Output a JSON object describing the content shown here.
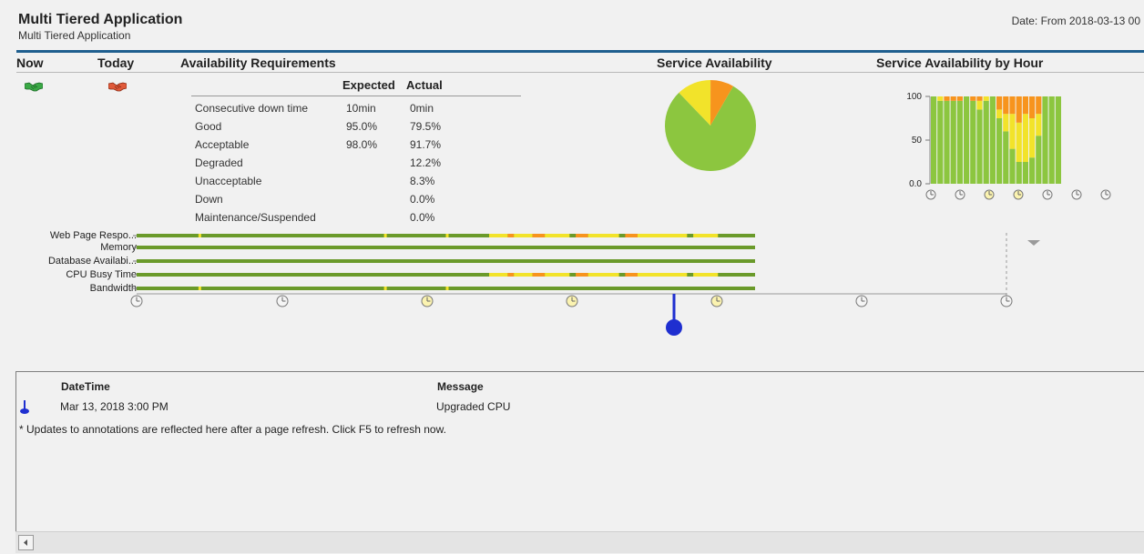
{
  "header": {
    "title": "Multi Tiered Application",
    "subtitle": "Multi Tiered Application",
    "date": "Date: From 2018-03-13 00"
  },
  "columns": {
    "now": "Now",
    "today": "Today",
    "availability_requirements": "Availability Requirements",
    "service_availability": "Service Availability",
    "service_availability_by_hour": "Service Availability by Hour"
  },
  "status_icons": {
    "now": {
      "icon": "handshake-icon",
      "color": "#3aa845"
    },
    "today": {
      "icon": "handshake-icon",
      "color": "#e05a3a"
    }
  },
  "requirements": {
    "headers": {
      "expected": "Expected",
      "actual": "Actual"
    },
    "rows": [
      {
        "label": "Consecutive down time",
        "expected": "10min",
        "actual": "0min"
      },
      {
        "label": "Good",
        "expected": "95.0%",
        "actual": "79.5%"
      },
      {
        "label": "Acceptable",
        "expected": "98.0%",
        "actual": "91.7%"
      },
      {
        "label": "Degraded",
        "expected": "",
        "actual": "12.2%"
      },
      {
        "label": "Unacceptable",
        "expected": "",
        "actual": "8.3%"
      },
      {
        "label": "Down",
        "expected": "",
        "actual": "0.0%"
      },
      {
        "label": "Maintenance/Suspended",
        "expected": "",
        "actual": "0.0%"
      }
    ]
  },
  "colors": {
    "good": "#8cc63f",
    "degraded": "#f2e32a",
    "unacceptable": "#f7941d",
    "track": "#6a9a2a",
    "annotation": "#1f2fd0"
  },
  "chart_data": [
    {
      "type": "pie",
      "title": "Service Availability",
      "slices": [
        {
          "name": "Good",
          "value": 79.5,
          "color": "#8cc63f"
        },
        {
          "name": "Degraded",
          "value": 12.2,
          "color": "#f2e32a"
        },
        {
          "name": "Unacceptable",
          "value": 8.3,
          "color": "#f7941d"
        }
      ]
    },
    {
      "type": "bar",
      "title": "Service Availability by Hour",
      "ylim": [
        0,
        100
      ],
      "yticks": [
        "100",
        "50",
        "0.0"
      ],
      "series": [
        {
          "name": "Good",
          "values": [
            100,
            95,
            95,
            95,
            95,
            100,
            95,
            85,
            95,
            100,
            75,
            60,
            40,
            25,
            25,
            30,
            55,
            100,
            100,
            100
          ]
        },
        {
          "name": "Degraded",
          "values": [
            0,
            5,
            0,
            0,
            0,
            0,
            0,
            10,
            5,
            0,
            10,
            20,
            40,
            45,
            55,
            45,
            25,
            0,
            0,
            0
          ]
        },
        {
          "name": "Unacceptable",
          "values": [
            0,
            0,
            5,
            5,
            5,
            0,
            5,
            5,
            0,
            0,
            15,
            20,
            20,
            30,
            20,
            25,
            20,
            0,
            0,
            0
          ]
        }
      ]
    }
  ],
  "timeline": {
    "labels": [
      "Web Page Respo...",
      "Memory",
      "Database Availabi...",
      "CPU Busy Time",
      "Bandwidth"
    ]
  },
  "annotations": {
    "headers": {
      "datetime": "DateTime",
      "message": "Message"
    },
    "rows": [
      {
        "datetime": "Mar 13, 2018 3:00 PM",
        "message": "Upgraded CPU"
      }
    ],
    "note": "* Updates to annotations are reflected here after a page refresh. Click F5 to refresh now."
  }
}
